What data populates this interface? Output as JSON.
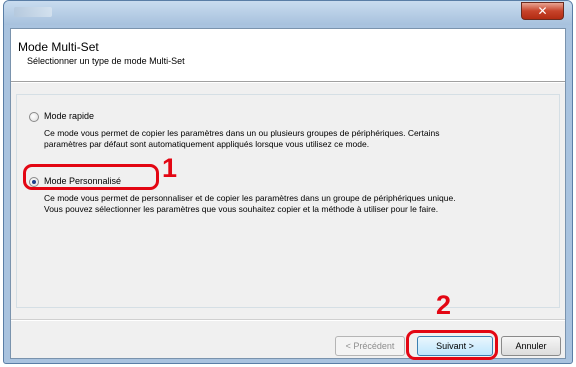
{
  "window": {
    "close_glyph": "✕"
  },
  "header": {
    "title": "Mode Multi-Set",
    "subtitle": "Sélectionner un type de mode Multi-Set"
  },
  "options": [
    {
      "label": "Mode rapide",
      "checked": false,
      "description_lines": [
        "Ce mode vous permet de copier les paramètres dans un ou plusieurs groupes de périphériques. Certains",
        "paramètres par défaut sont automatiquement appliqués lorsque vous utilisez ce mode."
      ]
    },
    {
      "label": "Mode Personnalisé",
      "checked": true,
      "description_lines": [
        "Ce mode vous permet de personnaliser et de copier les paramètres dans un groupe de périphériques unique.",
        "Vous pouvez sélectionner les paramètres que vous souhaitez copier et la méthode à utiliser pour le faire."
      ]
    }
  ],
  "callouts": {
    "step1": "1",
    "step2": "2",
    "color": "#e30613"
  },
  "buttons": {
    "previous": "< Précédent",
    "previous_enabled": false,
    "next": "Suivant >",
    "cancel": "Annuler"
  }
}
